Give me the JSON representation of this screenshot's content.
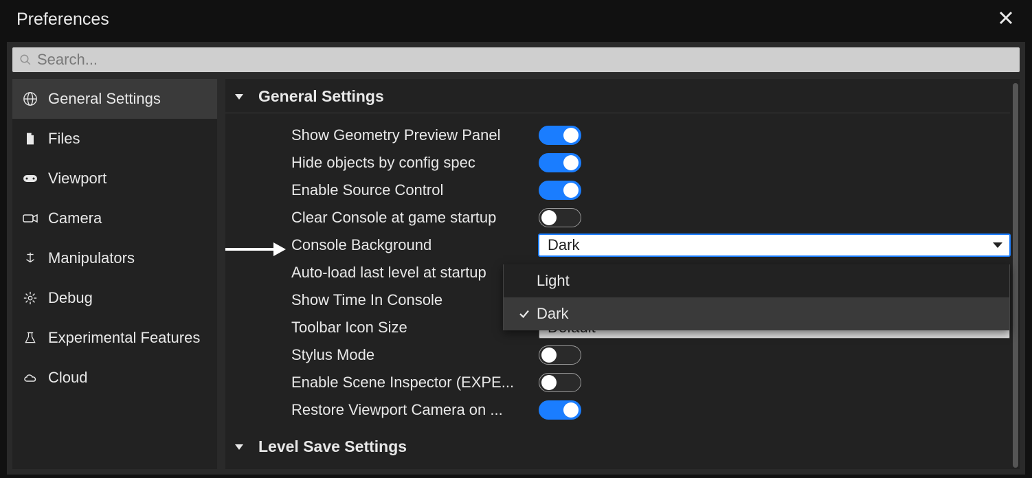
{
  "window": {
    "title": "Preferences"
  },
  "search": {
    "placeholder": "Search..."
  },
  "sidebar": {
    "items": [
      {
        "label": "General Settings",
        "icon": "globe",
        "active": true
      },
      {
        "label": "Files",
        "icon": "file",
        "active": false
      },
      {
        "label": "Viewport",
        "icon": "controller",
        "active": false
      },
      {
        "label": "Camera",
        "icon": "camera",
        "active": false
      },
      {
        "label": "Manipulators",
        "icon": "manip",
        "active": false
      },
      {
        "label": "Debug",
        "icon": "gear-bug",
        "active": false
      },
      {
        "label": "Experimental Features",
        "icon": "flask",
        "active": false
      },
      {
        "label": "Cloud",
        "icon": "cloud",
        "active": false
      }
    ]
  },
  "sections": {
    "general": {
      "title": "General Settings"
    },
    "levelsave": {
      "title": "Level Save Settings"
    }
  },
  "settings": {
    "show_geometry_preview": {
      "label": "Show Geometry Preview Panel",
      "value": true
    },
    "hide_objects_config_spec": {
      "label": "Hide objects by config spec",
      "value": true
    },
    "enable_source_control": {
      "label": "Enable Source Control",
      "value": true
    },
    "clear_console_startup": {
      "label": "Clear Console at game startup",
      "value": false
    },
    "console_background": {
      "label": "Console Background",
      "value": "Dark",
      "options": [
        "Light",
        "Dark"
      ]
    },
    "autoload_last_level": {
      "label": "Auto-load last level at startup",
      "value": false
    },
    "show_time_console": {
      "label": "Show Time In Console",
      "value": false
    },
    "toolbar_icon_size": {
      "label": "Toolbar Icon Size",
      "value": "Default"
    },
    "stylus_mode": {
      "label": "Stylus Mode",
      "value": false
    },
    "enable_scene_inspector": {
      "label": "Enable Scene Inspector (EXPE...",
      "value": false
    },
    "restore_viewport_camera": {
      "label": "Restore Viewport Camera on ...",
      "value": true
    }
  }
}
